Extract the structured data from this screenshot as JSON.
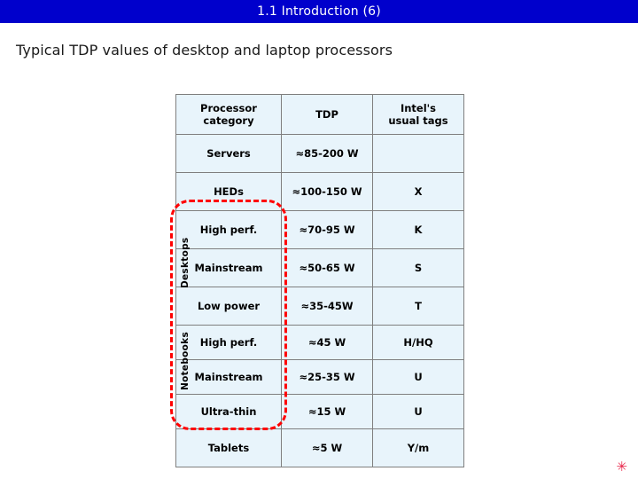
{
  "slide": {
    "title": "1.1 Introduction (6)",
    "subtitle": "Typical TDP values of desktop and laptop processors",
    "accent_color": "#0000cc",
    "highlight_color": "#ff0000",
    "table_cell_color": "#e8f4fb",
    "bottom_mark": "✳"
  },
  "side_labels": {
    "desktops": "Desktops",
    "notebooks": "Notebooks"
  },
  "table": {
    "headers": [
      "Processor category",
      "TDP",
      "Intel's usual tags"
    ],
    "header_lines": {
      "category_line1": "Processor",
      "category_line2": "category",
      "tdp": "TDP",
      "tags_line1": "Intel's",
      "tags_line2": "usual tags"
    },
    "rows": [
      {
        "category": "Servers",
        "tdp": "≈85-200 W",
        "tag": ""
      },
      {
        "category": "HEDs",
        "tdp": "≈100-150 W",
        "tag": "X"
      },
      {
        "category": "High perf.",
        "tdp": "≈70-95 W",
        "tag": "K"
      },
      {
        "category": "Mainstream",
        "tdp": "≈50-65 W",
        "tag": "S"
      },
      {
        "category": "Low power",
        "tdp": "≈35-45W",
        "tag": "T"
      },
      {
        "category": "High perf.",
        "tdp": "≈45 W",
        "tag": "H/HQ"
      },
      {
        "category": "Mainstream",
        "tdp": "≈25-35 W",
        "tag": "U"
      },
      {
        "category": "Ultra-thin",
        "tdp": "≈15 W",
        "tag": "U"
      },
      {
        "category": "Tablets",
        "tdp": "≈5 W",
        "tag": "Y/m"
      }
    ]
  }
}
